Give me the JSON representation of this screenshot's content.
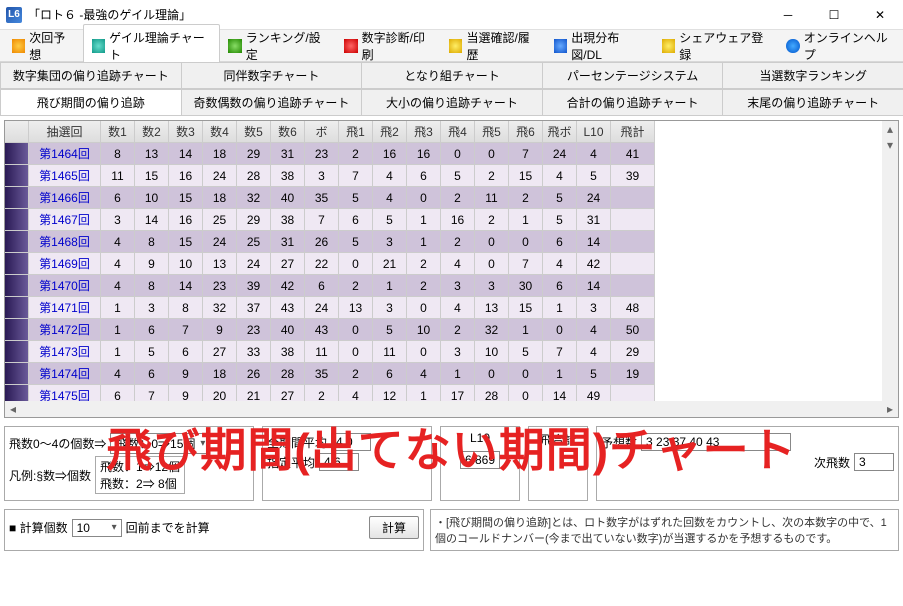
{
  "window": {
    "title": "「ロト６ -最強のゲイル理論」"
  },
  "toolbar": [
    {
      "label": "次回予想",
      "ic": "ic-orange",
      "name": "toolbtn-forecast"
    },
    {
      "label": "ゲイル理論チャート",
      "ic": "ic-teal",
      "name": "toolbtn-gail",
      "active": true
    },
    {
      "label": "ランキング/設定",
      "ic": "ic-green",
      "name": "toolbtn-ranking"
    },
    {
      "label": "数字診断/印刷",
      "ic": "ic-red",
      "name": "toolbtn-diag"
    },
    {
      "label": "当選確認/履歴",
      "ic": "ic-yellow",
      "name": "toolbtn-win"
    },
    {
      "label": "出現分布図/DL",
      "ic": "ic-blue",
      "name": "toolbtn-dist"
    },
    {
      "label": "シェアウェア登録",
      "ic": "ic-yellow",
      "name": "toolbtn-share"
    },
    {
      "label": "オンラインヘルプ",
      "ic": "ic-help",
      "name": "toolbtn-help"
    }
  ],
  "tabs_upper": [
    {
      "label": "数字集団の偏り追跡チャート"
    },
    {
      "label": "同伴数字チャート"
    },
    {
      "label": "となり組チャート"
    },
    {
      "label": "パーセンテージシステム"
    },
    {
      "label": "当選数字ランキング"
    }
  ],
  "tabs_lower": [
    {
      "label": "飛び期間の偏り追跡",
      "active": true
    },
    {
      "label": "奇数偶数の偏り追跡チャート"
    },
    {
      "label": "大小の偏り追跡チャート"
    },
    {
      "label": "合計の偏り追跡チャート"
    },
    {
      "label": "末尾の偏り追跡チャート"
    }
  ],
  "grid": {
    "headers": [
      "抽選回",
      "数1",
      "数2",
      "数3",
      "数4",
      "数5",
      "数6",
      "ボ",
      "飛1",
      "飛2",
      "飛3",
      "飛4",
      "飛5",
      "飛6",
      "飛ボ",
      "L10",
      "飛計"
    ],
    "rows": [
      {
        "kai": "第1464回",
        "v": [
          8,
          13,
          14,
          18,
          29,
          31,
          23,
          2,
          16,
          16,
          0,
          0,
          7,
          24,
          4,
          41
        ]
      },
      {
        "kai": "第1465回",
        "v": [
          11,
          15,
          16,
          24,
          28,
          38,
          3,
          7,
          4,
          6,
          5,
          2,
          15,
          4,
          5,
          39
        ]
      },
      {
        "kai": "第1466回",
        "v": [
          6,
          10,
          15,
          18,
          32,
          40,
          35,
          5,
          4,
          0,
          2,
          11,
          2,
          5,
          24
        ]
      },
      {
        "kai": "第1467回",
        "v": [
          3,
          14,
          16,
          25,
          29,
          38,
          7,
          6,
          5,
          1,
          16,
          2,
          1,
          5,
          31
        ]
      },
      {
        "kai": "第1468回",
        "v": [
          4,
          8,
          15,
          24,
          25,
          31,
          26,
          5,
          3,
          1,
          2,
          0,
          0,
          6,
          14
        ]
      },
      {
        "kai": "第1469回",
        "v": [
          4,
          9,
          10,
          13,
          24,
          27,
          22,
          0,
          21,
          2,
          4,
          0,
          7,
          4,
          42
        ]
      },
      {
        "kai": "第1470回",
        "v": [
          4,
          8,
          14,
          23,
          39,
          42,
          6,
          2,
          1,
          2,
          3,
          3,
          30,
          6,
          14
        ]
      },
      {
        "kai": "第1471回",
        "v": [
          1,
          3,
          8,
          32,
          37,
          43,
          24,
          13,
          3,
          0,
          4,
          13,
          15,
          1,
          3,
          48
        ]
      },
      {
        "kai": "第1472回",
        "v": [
          1,
          6,
          7,
          9,
          23,
          40,
          43,
          0,
          5,
          10,
          2,
          32,
          1,
          0,
          4,
          50
        ]
      },
      {
        "kai": "第1473回",
        "v": [
          1,
          5,
          6,
          27,
          33,
          38,
          11,
          0,
          11,
          0,
          3,
          10,
          5,
          7,
          4,
          29
        ]
      },
      {
        "kai": "第1474回",
        "v": [
          4,
          6,
          9,
          18,
          26,
          28,
          35,
          2,
          6,
          4,
          1,
          0,
          0,
          1,
          5,
          19
        ]
      },
      {
        "kai": "第1475回",
        "v": [
          6,
          7,
          9,
          20,
          21,
          27,
          2,
          4,
          12,
          1,
          17,
          28,
          0,
          14,
          49
        ]
      }
    ]
  },
  "panels": {
    "flycount_label": "飛数0～4の個数⇒",
    "flycount_sel": "飛数：0⇒15個",
    "legend_label": "凡例:§数⇒個数",
    "legend_line1": "飛数：1⇒12個",
    "legend_line2": "飛数：2⇒ 8個",
    "zenki_label": "全期間平均",
    "zenki_val": "4.0",
    "shitei_label": "指定平均",
    "shitei_val": "4.6",
    "l10_header": "L10",
    "l10_val": "6.869",
    "tobigoukei": "飛合計",
    "yosou_label": "予想数",
    "yosou_val": "3  23  37  40  43",
    "jikai_label": "次飛数",
    "jikai_val": "3",
    "calc_label": "■ 計算個数",
    "calc_sel": "10",
    "calc_text": "回前までを計算",
    "calc_btn": "計算",
    "note": "・[飛び期間の偏り追跡]とは、ロト数字がはずれた回数をカウントし、次の本数字の中で、1個のコールドナンバー(今まで出ていない数字)が当選するかを予想するものです。"
  },
  "overlay": "飛び期間(出てない期間)チャート"
}
